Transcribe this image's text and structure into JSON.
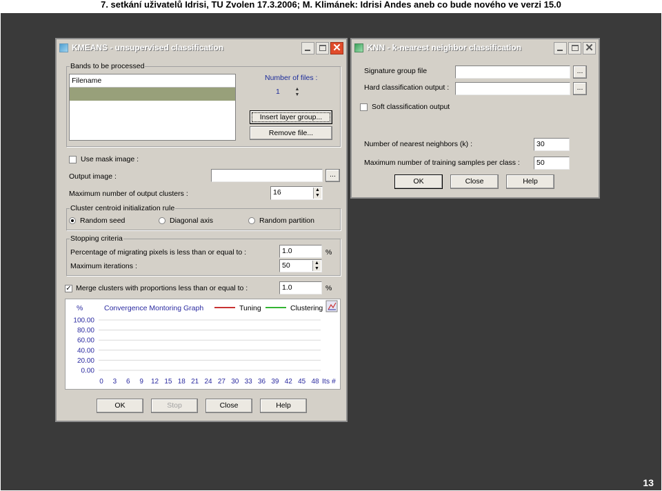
{
  "slide": {
    "title": "7. setkání uživatelů Idrisi, TU Zvolen 17.3.2006; M. Klimánek: Idrisi Andes aneb co bude nového ve verzi 15.0",
    "page_number": "13"
  },
  "kmeans": {
    "title": "KMEANS - unsupervised classification",
    "bands_group": "Bands to be processed",
    "filename_header": "Filename",
    "number_of_files_label": "Number of files :",
    "number_of_files_value": "1",
    "insert_layer_group": "Insert layer group...",
    "remove_file": "Remove file...",
    "use_mask_label": "Use mask image :",
    "output_image_label": "Output image :",
    "output_image_value": "",
    "browse_label": "...",
    "max_clusters_label": "Maximum number of output clusters :",
    "max_clusters_value": "16",
    "centroid_group": "Cluster centroid initialization rule",
    "radio_random_seed": "Random seed",
    "radio_diagonal": "Diagonal axis",
    "radio_random_partition": "Random partition",
    "stopping_group": "Stopping criteria",
    "migrating_label": "Percentage of migrating pixels is less than or equal to :",
    "migrating_value": "1.0",
    "percent_sign": "%",
    "max_iter_label": "Maximum iterations :",
    "max_iter_value": "50",
    "merge_label": "Merge clusters with proportions less than or equal to :",
    "merge_value": "1.0",
    "graph": {
      "y_unit": "%",
      "title": "Convergence Montoring Graph",
      "legend_tuning": "Tuning",
      "legend_clustering": "Clustering",
      "tuning_color": "#c83232",
      "clustering_color": "#32b432",
      "title_color": "#2a2aa0",
      "y_ticks": [
        "100.00",
        "80.00",
        "60.00",
        "40.00",
        "20.00",
        "0.00"
      ],
      "x_ticks": [
        "0",
        "3",
        "6",
        "9",
        "12",
        "15",
        "18",
        "21",
        "24",
        "27",
        "30",
        "33",
        "36",
        "39",
        "42",
        "45",
        "48"
      ],
      "x_unit": "Its #"
    },
    "buttons": {
      "ok": "OK",
      "stop": "Stop",
      "close": "Close",
      "help": "Help"
    }
  },
  "knn": {
    "title": "KNN - k-nearest neighbor classification",
    "signature_label": "Signature group file",
    "signature_value": "",
    "hard_output_label": "Hard classification output :",
    "hard_output_value": "",
    "browse_label": "...",
    "soft_output_label": "Soft classification output",
    "k_label": "Number of nearest neighbors (k) :",
    "k_value": "30",
    "max_samples_label": "Maximum number of training samples per class :",
    "max_samples_value": "50",
    "buttons": {
      "ok": "OK",
      "close": "Close",
      "help": "Help"
    }
  }
}
